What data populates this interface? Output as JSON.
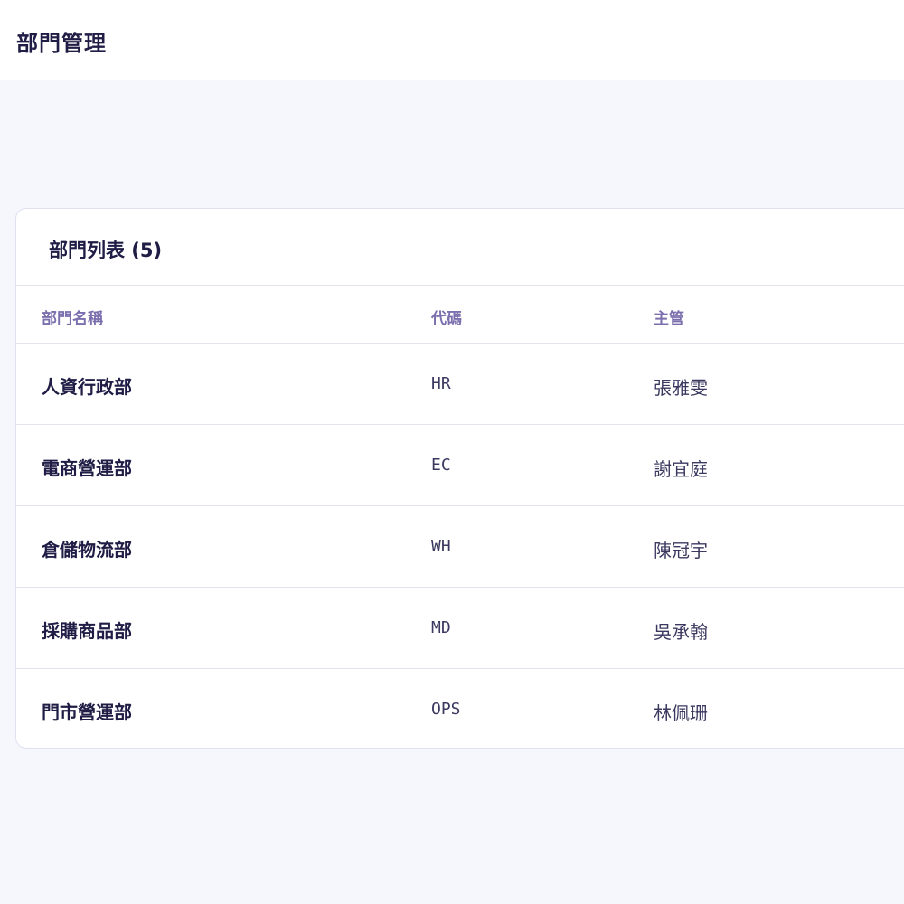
{
  "header": {
    "title": "部門管理"
  },
  "card": {
    "title": "部門列表 (5)"
  },
  "table": {
    "columns": [
      "部門名稱",
      "代碼",
      "主管"
    ],
    "rows": [
      {
        "name": "人資行政部",
        "code": "HR",
        "manager": "張雅雯"
      },
      {
        "name": "電商營運部",
        "code": "EC",
        "manager": "謝宜庭"
      },
      {
        "name": "倉儲物流部",
        "code": "WH",
        "manager": "陳冠宇"
      },
      {
        "name": "採購商品部",
        "code": "MD",
        "manager": "吳承翰"
      },
      {
        "name": "門市營運部",
        "code": "OPS",
        "manager": "林佩珊"
      }
    ]
  },
  "colors": {
    "background": "#f6f6fd",
    "text": "#1f1d45",
    "header_text": "#7b6fae",
    "border": "#e3e2ef"
  }
}
